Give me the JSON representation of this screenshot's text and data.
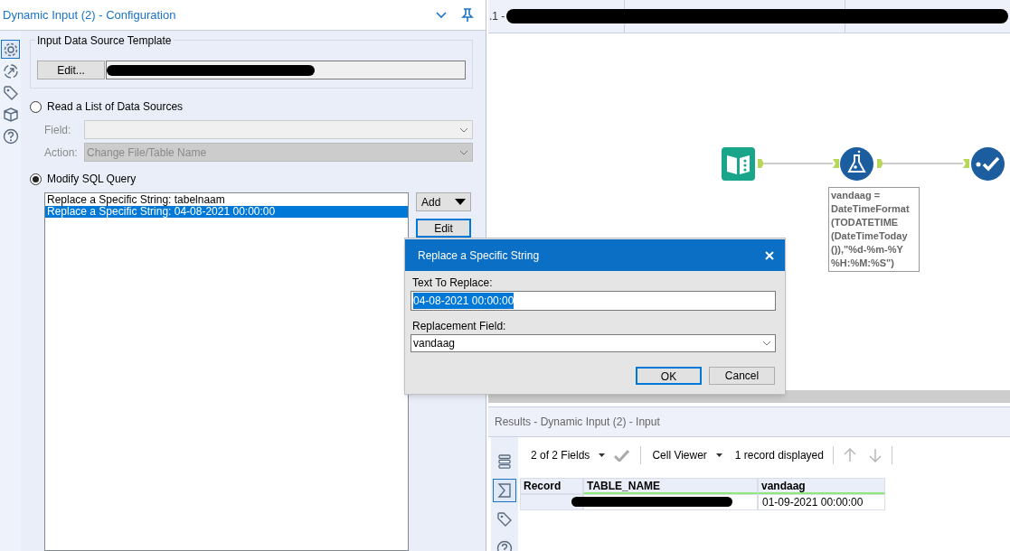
{
  "config_panel": {
    "title": "Dynamic Input (2) - Configuration",
    "side_icons": [
      {
        "kind": "gear",
        "selected": true
      },
      {
        "kind": "connection",
        "selected": false
      },
      {
        "kind": "tag",
        "selected": false
      },
      {
        "kind": "cube",
        "selected": false
      },
      {
        "kind": "help",
        "selected": false
      }
    ],
    "template": {
      "legend": "Input Data Source Template",
      "edit_button": "Edit...",
      "path_redacted": true
    },
    "modes": [
      {
        "label": "Read a List of Data Sources",
        "selected": false
      },
      {
        "label": "Modify SQL Query",
        "selected": true
      }
    ],
    "list_source": {
      "field_label": "Field:",
      "action_label": "Action:",
      "action_value": "Change File/Table Name",
      "disabled": true
    },
    "sql_list": [
      {
        "label": "Replace a Specific String: tabelnaam",
        "selected": false
      },
      {
        "label": "Replace a Specific String: 04-08-2021 00:00:00",
        "selected": true
      }
    ],
    "buttons": [
      {
        "label": "Add",
        "kind": "dropdown"
      },
      {
        "label": "Edit",
        "kind": "focused"
      }
    ]
  },
  "canvas": {
    "tab_label": ".1 -",
    "tab_redacted": true,
    "nodes": [
      {
        "kind": "input"
      },
      {
        "kind": "formula"
      },
      {
        "kind": "browse"
      }
    ],
    "annotation_lines": [
      "vandaag =",
      "DateTimeFormat",
      "(TODATETIME",
      "(DateTimeToday",
      "()),\"%d-%m-%Y",
      "%H:%M:%S\")"
    ]
  },
  "dialog": {
    "title": "Replace a Specific String",
    "text_label": "Text To Replace:",
    "text_value": "04-08-2021 00:00:00",
    "field_label": "Replacement Field:",
    "field_value": "vandaag",
    "ok": "OK",
    "cancel": "Cancel"
  },
  "results": {
    "title": "Results - Dynamic Input (2) - Input",
    "side_icons": [
      {
        "kind": "rows",
        "selected": false
      },
      {
        "kind": "sum",
        "selected": true
      },
      {
        "kind": "tag",
        "selected": false
      },
      {
        "kind": "help",
        "selected": false
      }
    ],
    "fields": "2 of 2 Fields",
    "viewer": "Cell Viewer",
    "records": "1 record displayed",
    "columns": [
      "Record",
      "TABLE_NAME",
      "vandaag"
    ],
    "rows": [
      {
        "table_name_redacted": true,
        "vandaag": "01-09-2021 00:00:00"
      }
    ]
  }
}
